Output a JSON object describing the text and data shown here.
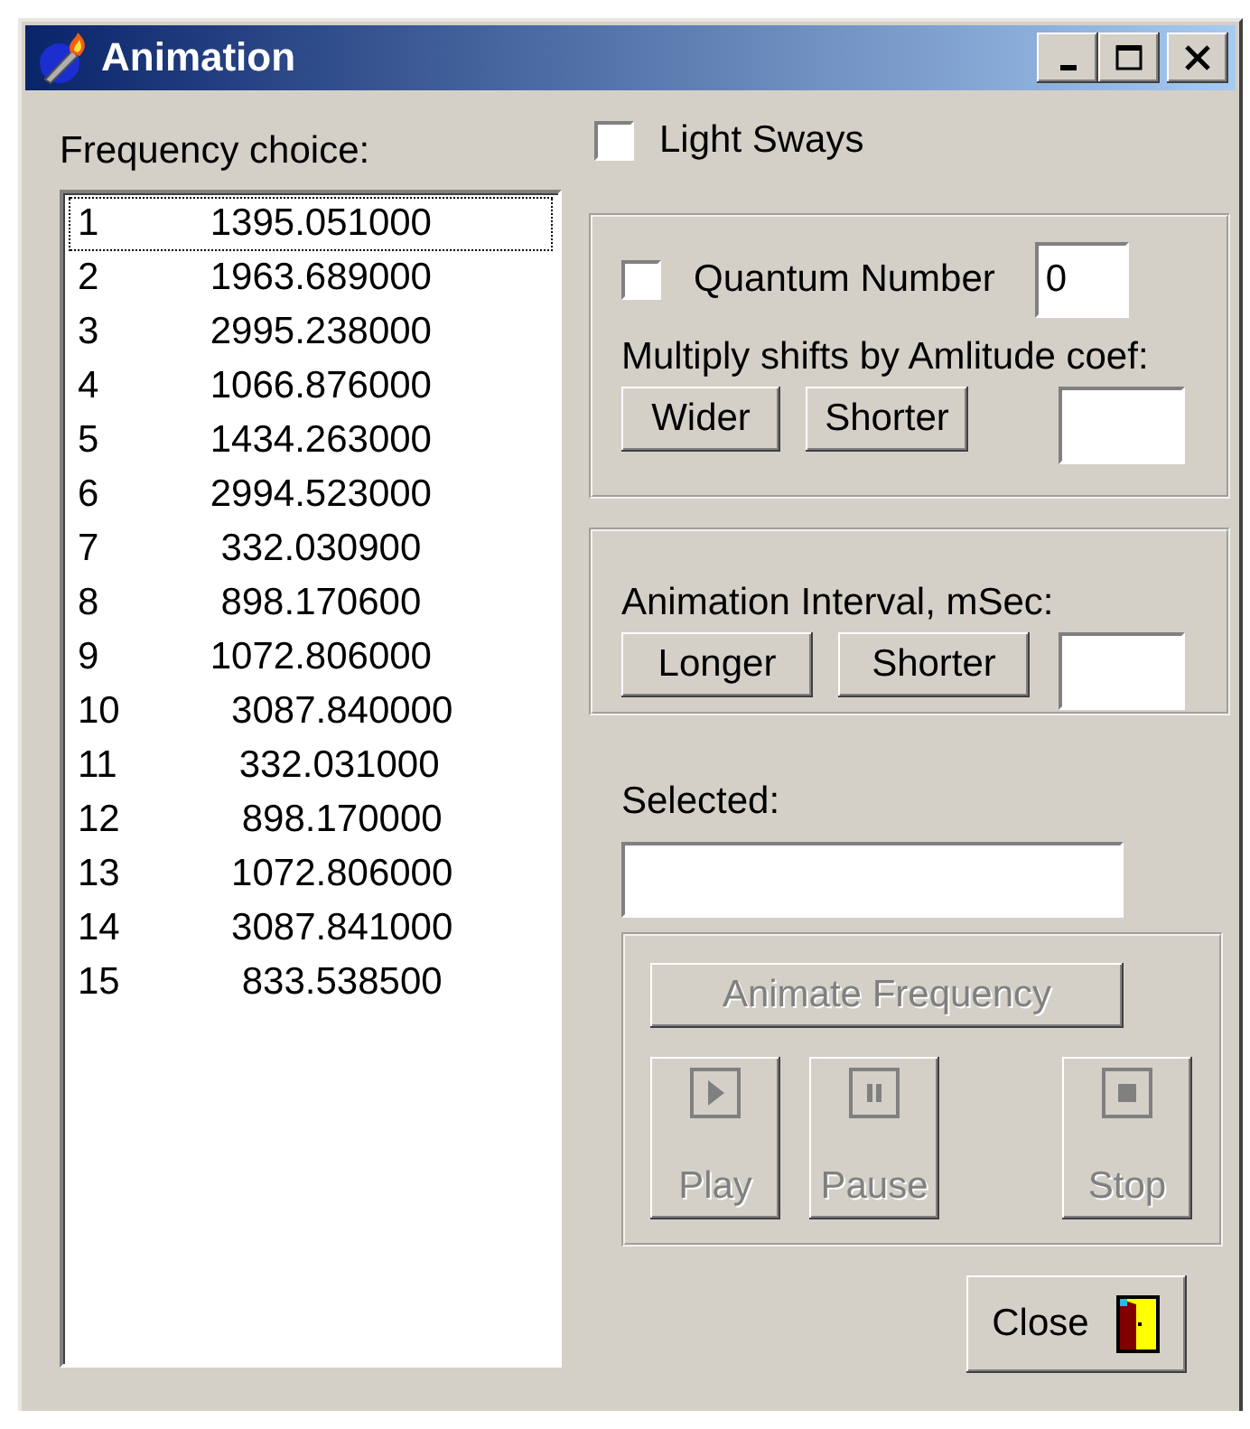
{
  "window": {
    "title": "Animation"
  },
  "frequency_list": {
    "label": "Frequency choice:",
    "items": [
      {
        "index": "1",
        "value": "1395.051000",
        "focused": true
      },
      {
        "index": "2",
        "value": "1963.689000",
        "focused": false
      },
      {
        "index": "3",
        "value": "2995.238000",
        "focused": false
      },
      {
        "index": "4",
        "value": "1066.876000",
        "focused": false
      },
      {
        "index": "5",
        "value": "1434.263000",
        "focused": false
      },
      {
        "index": "6",
        "value": "2994.523000",
        "focused": false
      },
      {
        "index": "7",
        "value": "332.030900",
        "focused": false
      },
      {
        "index": "8",
        "value": "898.170600",
        "focused": false
      },
      {
        "index": "9",
        "value": "1072.806000",
        "focused": false
      },
      {
        "index": "10",
        "value": "3087.840000",
        "focused": false
      },
      {
        "index": "11",
        "value": "332.031000",
        "focused": false
      },
      {
        "index": "12",
        "value": "898.170000",
        "focused": false
      },
      {
        "index": "13",
        "value": "1072.806000",
        "focused": false
      },
      {
        "index": "14",
        "value": "3087.841000",
        "focused": false
      },
      {
        "index": "15",
        "value": "833.538500",
        "focused": false
      }
    ]
  },
  "light_sways": {
    "label": "Light Sways",
    "checked": false
  },
  "amplitude_group": {
    "quantum": {
      "label": "Quantum Number",
      "checked": false,
      "value": "0"
    },
    "label": "Multiply shifts by Amlitude coef:",
    "buttons": [
      "Wider",
      "Shorter"
    ]
  },
  "interval_group": {
    "label": "Animation Interval, mSec:",
    "buttons": [
      "Longer",
      "Shorter"
    ]
  },
  "selected_field": {
    "label": "Selected:"
  },
  "animate_group": {
    "animate_button": {
      "label": "Animate Frequency",
      "disabled": true
    },
    "transport": [
      {
        "kind": "play",
        "label": "Play",
        "disabled": true
      },
      {
        "kind": "pause",
        "label": "Pause",
        "disabled": true
      },
      {
        "kind": "stop",
        "label": "Stop",
        "disabled": true
      }
    ]
  },
  "close_button": {
    "label": "Close"
  }
}
